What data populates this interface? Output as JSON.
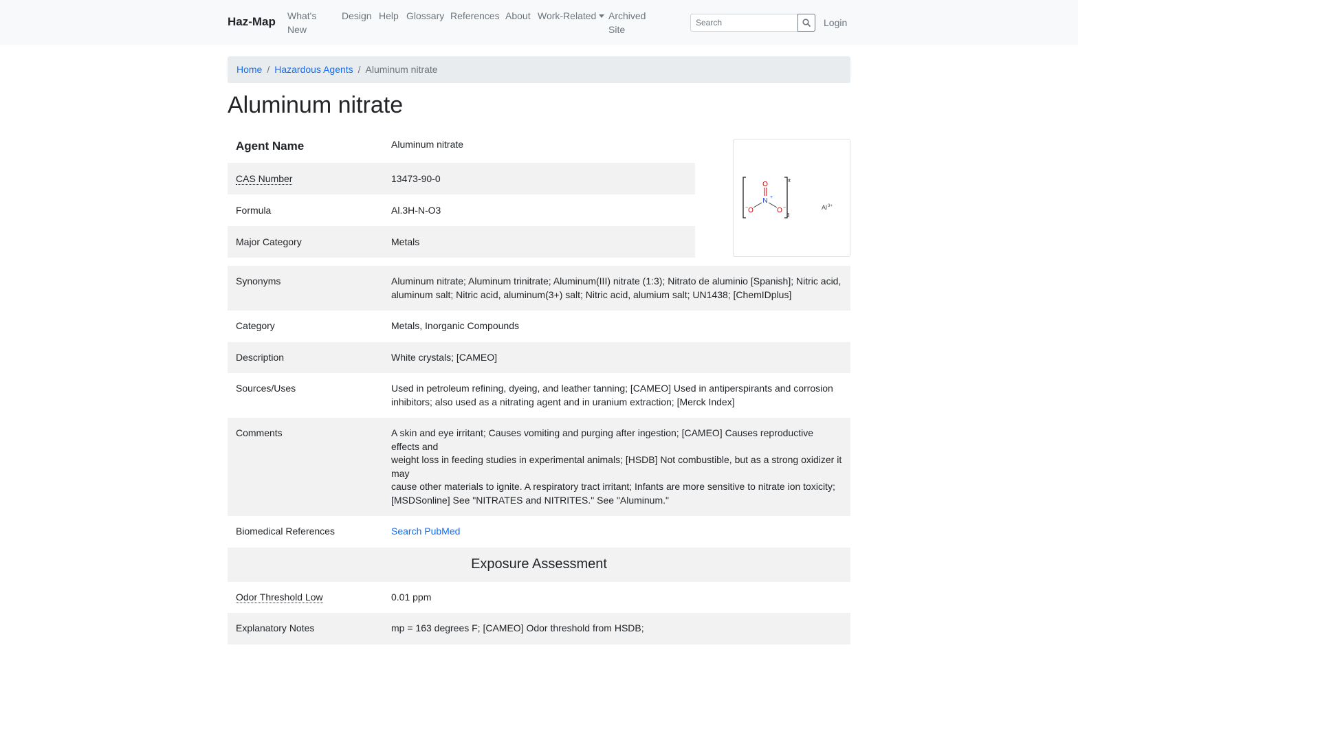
{
  "navbar": {
    "brand": "Haz-Map",
    "links": {
      "whats_new_1": "What's",
      "whats_new_2": "New",
      "design": "Design",
      "help": "Help",
      "glossary": "Glossary",
      "references": "References",
      "about": "About",
      "work_related": "Work-Related",
      "archived_1": "Archived",
      "archived_2": "Site"
    },
    "search_placeholder": "Search",
    "login": "Login"
  },
  "breadcrumb": {
    "home": "Home",
    "hazardous_agents": "Hazardous Agents",
    "current": "Aluminum nitrate"
  },
  "page_title": "Aluminum nitrate",
  "agent": {
    "agent_name_label": "Agent Name",
    "agent_name": "Aluminum nitrate",
    "cas_label": "CAS Number",
    "cas": "13473-90-0",
    "formula_label": "Formula",
    "formula": "Al.3H-N-O3",
    "major_category_label": "Major Category",
    "major_category": "Metals"
  },
  "structure": {
    "o_top": "O",
    "n_center": "N",
    "n_charge": "+",
    "o_left": "O",
    "o_right": "O",
    "minus": "−",
    "subscript": "3",
    "corner": "nt",
    "al": "Al",
    "al_charge": "3+"
  },
  "details": {
    "synonyms_label": "Synonyms",
    "synonyms_1": "Aluminum nitrate; Aluminum trinitrate; Aluminum(III) nitrate (1:3); Nitrato de aluminio [Spanish]; Nitric acid,",
    "synonyms_2": "aluminum salt; Nitric acid, aluminum(3+) salt; Nitric acid, alumium salt; UN1438; [ChemIDplus]",
    "category_label": "Category",
    "category": "Metals, Inorganic Compounds",
    "description_label": "Description",
    "description": "White crystals; [CAMEO]",
    "sources_label": "Sources/Uses",
    "sources_1": "Used in petroleum refining, dyeing, and leather tanning; [CAMEO] Used in antiperspirants and corrosion",
    "sources_2": "inhibitors; also used as a nitrating agent and in uranium extraction; [Merck Index]",
    "comments_label": "Comments",
    "comments_1": "A skin and eye irritant; Causes vomiting and purging after ingestion; [CAMEO] Causes reproductive effects and",
    "comments_2": "weight loss in feeding studies in experimental animals; [HSDB] Not combustible, but as a strong oxidizer it may",
    "comments_3": "cause other materials to ignite. A respiratory tract irritant; Infants are more sensitive to nitrate ion toxicity;",
    "comments_4": "[MSDSonline] See \"NITRATES and NITRITES.\" See \"Aluminum.\"",
    "biomed_label": "Biomedical References",
    "biomed_link": "Search PubMed"
  },
  "exposure": {
    "heading": "Exposure Assessment",
    "odor_label": "Odor Threshold Low",
    "odor": "0.01 ppm",
    "notes_label": "Explanatory Notes",
    "notes": "mp = 163 degrees F; [CAMEO] Odor threshold from HSDB;"
  }
}
